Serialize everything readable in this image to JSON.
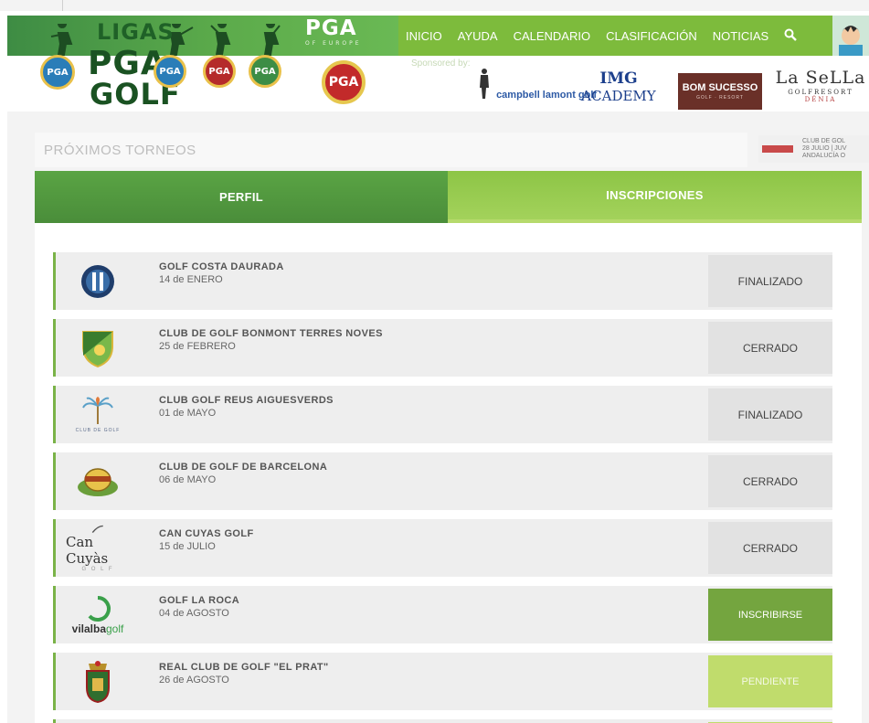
{
  "header": {
    "brand_line1": "LIGAS",
    "brand_line2": "PGA",
    "brand_line3": "GOLF",
    "badge_text": "PGA",
    "pga_europe_main": "PGA",
    "pga_europe_sub": "OF EUROPE",
    "nav": [
      "INICIO",
      "AYUDA",
      "CALENDARIO",
      "CLASIFICACIÓN",
      "NOTICIAS"
    ],
    "search_icon": "search-icon",
    "sponsored_label": "Sponsored by:",
    "sponsors": {
      "campbell": "campbell lamont golf",
      "img_line1": "IMG",
      "img_line2": "ACADEMY",
      "bom": "BOM SUCESSO",
      "bom_sub": "GOLF · RESORT",
      "sella_line1": "La SeLLa",
      "sella_line2": "GOLFRESORT",
      "sella_line3": "DÉNIA"
    }
  },
  "upcoming": {
    "label": "PRÓXIMOS TORNEOS",
    "event_line1": "CLUB DE GOL",
    "event_line2": "28 JULIO | JUV",
    "event_line3": "ANDALUCÍA O"
  },
  "tabs": {
    "perfil": "PERFIL",
    "inscripciones": "INSCRIPCIONES"
  },
  "tournaments": [
    {
      "name": "GOLF COSTA DAURADA",
      "date": "14 de ENERO",
      "status": "FINALIZADO",
      "status_style": "gray"
    },
    {
      "name": "CLUB DE GOLF BONMONT TERRES NOVES",
      "date": "25 de FEBRERO",
      "status": "CERRADO",
      "status_style": "gray"
    },
    {
      "name": "CLUB GOLF REUS AIGUESVERDS",
      "date": "01 de MAYO",
      "status": "FINALIZADO",
      "status_style": "gray"
    },
    {
      "name": "CLUB DE GOLF DE BARCELONA",
      "date": "06 de MAYO",
      "status": "CERRADO",
      "status_style": "gray"
    },
    {
      "name": "CAN CUYAS GOLF",
      "date": "15 de JULIO",
      "status": "CERRADO",
      "status_style": "gray"
    },
    {
      "name": "GOLF LA ROCA",
      "date": "04 de AGOSTO",
      "status": "INSCRIBIRSE",
      "status_style": "green"
    },
    {
      "name": "REAL CLUB DE GOLF \"EL PRAT\"",
      "date": "26 de AGOSTO",
      "status": "PENDIENTE",
      "status_style": "lime"
    }
  ],
  "logos": {
    "reus": "CLUB DE GOLF",
    "cancuyas": "Can Cuyàs",
    "cancuyas_sub": "G O L F",
    "vilalba_1": "vilalba",
    "vilalba_2": "golf"
  },
  "colors": {
    "nav_green": "#7dbb3c",
    "brand_green": "#4a9a48",
    "row_accent": "#7ab348",
    "inscribirse": "#74a53f",
    "pendiente": "#c0dc6c"
  }
}
